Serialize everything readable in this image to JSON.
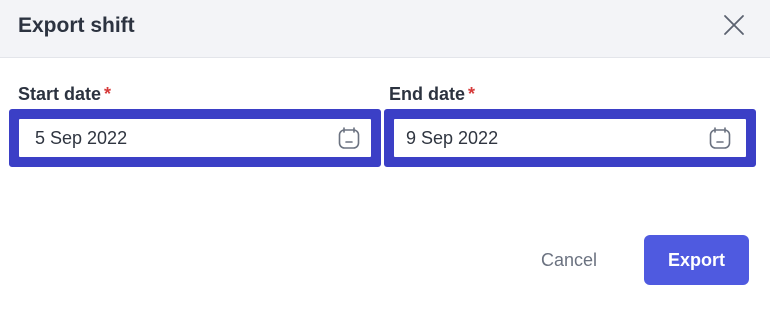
{
  "dialog": {
    "title": "Export shift",
    "close_icon": "close-icon"
  },
  "fields": {
    "start": {
      "label": "Start date",
      "required_marker": "*",
      "value": "5 Sep 2022",
      "icon": "calendar-icon"
    },
    "end": {
      "label": "End date",
      "required_marker": "*",
      "value": "9 Sep 2022",
      "icon": "calendar-icon"
    }
  },
  "actions": {
    "cancel_label": "Cancel",
    "export_label": "Export"
  },
  "colors": {
    "header_bg": "#f3f4f7",
    "focus_border": "#3b3fc6",
    "primary": "#4f5ae0",
    "required": "#d63a3a",
    "text": "#2c3340",
    "muted": "#6b7280"
  }
}
